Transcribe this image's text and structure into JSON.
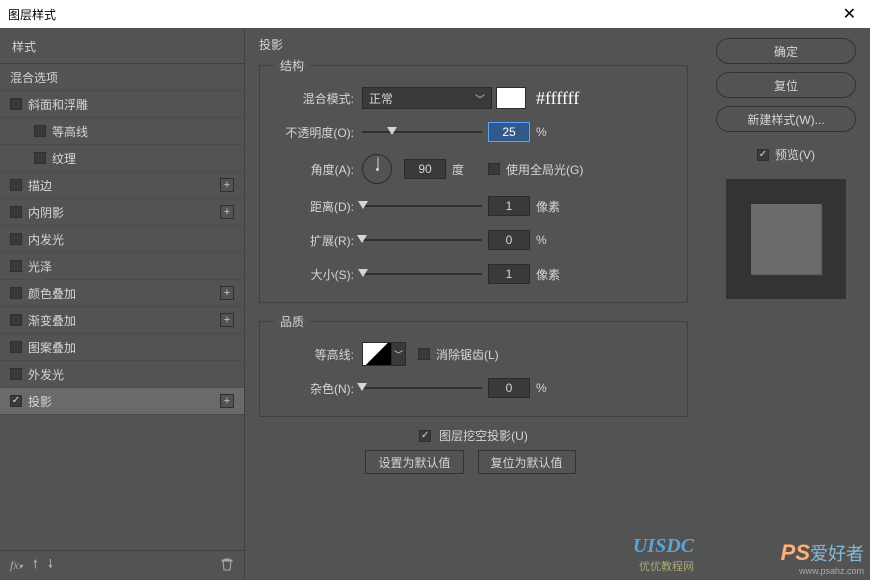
{
  "title": "图层样式",
  "sidebar": {
    "header": "样式",
    "blending": "混合选项",
    "items": [
      {
        "label": "斜面和浮雕",
        "checked": false,
        "add": false
      },
      {
        "label": "等高线",
        "checked": false,
        "add": false,
        "child": true
      },
      {
        "label": "纹理",
        "checked": false,
        "add": false,
        "child": true
      },
      {
        "label": "描边",
        "checked": false,
        "add": true
      },
      {
        "label": "内阴影",
        "checked": false,
        "add": true
      },
      {
        "label": "内发光",
        "checked": false,
        "add": false
      },
      {
        "label": "光泽",
        "checked": false,
        "add": false
      },
      {
        "label": "颜色叠加",
        "checked": false,
        "add": true
      },
      {
        "label": "渐变叠加",
        "checked": false,
        "add": true
      },
      {
        "label": "图案叠加",
        "checked": false,
        "add": false
      },
      {
        "label": "外发光",
        "checked": false,
        "add": false
      },
      {
        "label": "投影",
        "checked": true,
        "add": true,
        "active": true
      }
    ],
    "footer": {
      "fx": "fx"
    }
  },
  "main": {
    "title": "投影",
    "structure": {
      "legend": "结构",
      "blendModeLabel": "混合模式:",
      "blendModeValue": "正常",
      "colorHex": "#ffffff",
      "opacityLabel": "不透明度(O):",
      "opacityValue": "25",
      "opacityUnit": "%",
      "angleLabel": "角度(A):",
      "angleValue": "90",
      "angleUnit": "度",
      "globalLight": "使用全局光(G)",
      "distanceLabel": "距离(D):",
      "distanceValue": "1",
      "distanceUnit": "像素",
      "spreadLabel": "扩展(R):",
      "spreadValue": "0",
      "spreadUnit": "%",
      "sizeLabel": "大小(S):",
      "sizeValue": "1",
      "sizeUnit": "像素"
    },
    "quality": {
      "legend": "品质",
      "contourLabel": "等高线:",
      "antiAlias": "消除锯齿(L)",
      "noiseLabel": "杂色(N):",
      "noiseValue": "0",
      "noiseUnit": "%"
    },
    "knockout": "图层挖空投影(U)",
    "defaultBtn": "设置为默认值",
    "resetBtn": "复位为默认值"
  },
  "right": {
    "ok": "确定",
    "cancel": "复位",
    "newStyle": "新建样式(W)...",
    "preview": "预览(V)"
  },
  "chart_data": {
    "type": "table",
    "title": "投影 (Drop Shadow) parameters",
    "rows": [
      {
        "param": "混合模式",
        "value": "正常"
      },
      {
        "param": "颜色",
        "value": "#ffffff"
      },
      {
        "param": "不透明度",
        "value": 25,
        "unit": "%"
      },
      {
        "param": "角度",
        "value": 90,
        "unit": "度"
      },
      {
        "param": "使用全局光",
        "value": false
      },
      {
        "param": "距离",
        "value": 1,
        "unit": "像素"
      },
      {
        "param": "扩展",
        "value": 0,
        "unit": "%"
      },
      {
        "param": "大小",
        "value": 1,
        "unit": "像素"
      },
      {
        "param": "消除锯齿",
        "value": false
      },
      {
        "param": "杂色",
        "value": 0,
        "unit": "%"
      },
      {
        "param": "图层挖空投影",
        "value": true
      }
    ]
  },
  "watermark": {
    "brand": "UISDC",
    "sub": "优优教程网",
    "ps": "PS",
    "ah": "爱好者",
    "url": "www.psahz.com"
  }
}
